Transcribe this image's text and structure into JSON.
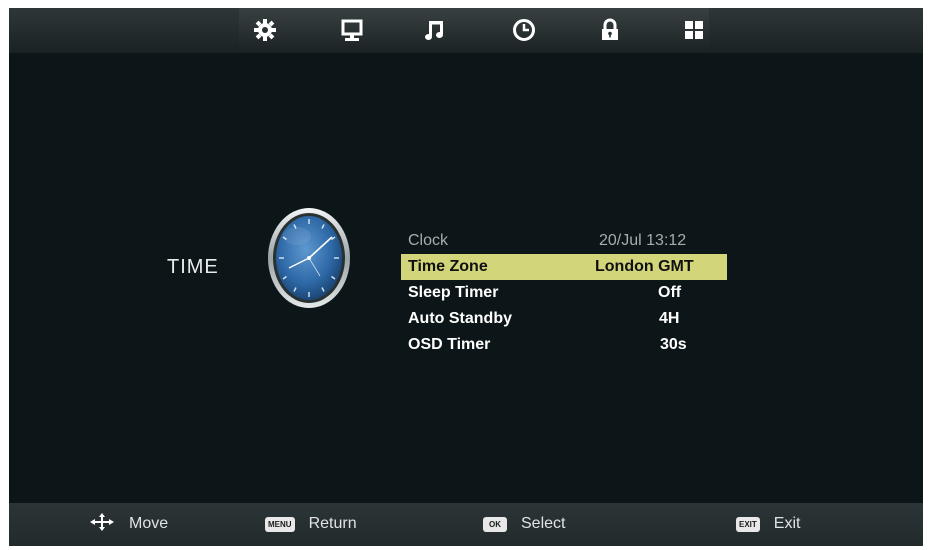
{
  "tabs": [
    {
      "icon": "picture-settings-icon",
      "label": ""
    },
    {
      "icon": "monitor-icon",
      "label": ""
    },
    {
      "icon": "music-note-icon",
      "label": ""
    },
    {
      "icon": "clock-icon",
      "label": ""
    },
    {
      "icon": "lock-icon",
      "label": ""
    },
    {
      "icon": "grid-icon",
      "label": ""
    }
  ],
  "active_tab": "clock-icon",
  "section": {
    "title": "TIME",
    "icon": "analog-clock-icon"
  },
  "menu": {
    "items": [
      {
        "label": "Clock",
        "value": "20/Jul 13:12",
        "state": "disabled"
      },
      {
        "label": "Time Zone",
        "value": "London GMT",
        "state": "selected"
      },
      {
        "label": "Sleep Timer",
        "value": "Off",
        "state": "normal"
      },
      {
        "label": "Auto Standby",
        "value": "4H",
        "state": "normal"
      },
      {
        "label": "OSD Timer",
        "value": "30s",
        "state": "normal"
      }
    ]
  },
  "footer": {
    "move": {
      "icon": "dpad-arrows-icon",
      "label": "Move"
    },
    "return": {
      "key": "MENU",
      "label": "Return"
    },
    "select": {
      "key": "OK",
      "label": "Select"
    },
    "exit": {
      "key": "EXIT",
      "label": "Exit"
    }
  },
  "colors": {
    "background": "#0c1517",
    "bar": "#262e30",
    "highlight": "#d3d57a",
    "clock_face": "#2f6aa8"
  }
}
